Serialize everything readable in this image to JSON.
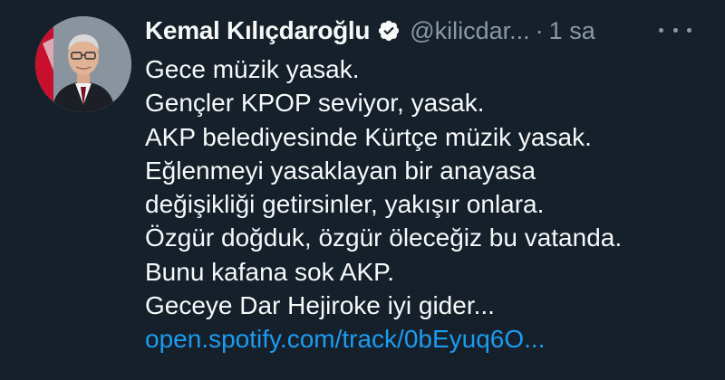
{
  "tweet": {
    "author_name": "Kemal Kılıçdaroğlu",
    "handle": "@kilicdar...",
    "separator": "·",
    "timestamp": "1 sa",
    "lines": [
      "Gece müzik yasak.",
      "Gençler KPOP seviyor, yasak.",
      "AKP belediyesinde Kürtçe müzik yasak.",
      "Eğlenmeyi yasaklayan bir anayasa",
      "değişikliği getirsinler, yakışır onlara.",
      "Özgür doğduk, özgür öleceğiz bu vatanda.",
      "Bunu kafana sok AKP.",
      "Geceye Dar Hejiroke iyi gider..."
    ],
    "link": "open.spotify.com/track/0bEyuq6O..."
  },
  "icons": {
    "verified": "verified-badge-icon",
    "more": "more-options-icon"
  },
  "colors": {
    "background": "#15202b",
    "text": "#f7f9f9",
    "secondary_text": "#8b98a5",
    "link": "#1d9bf0"
  }
}
